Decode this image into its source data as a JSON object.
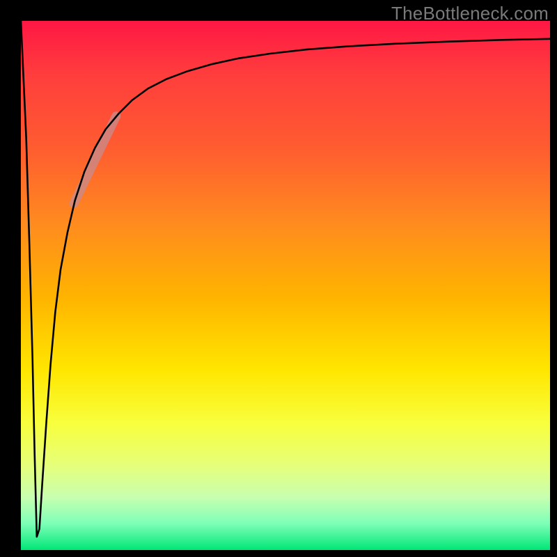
{
  "watermark": "TheBottleneck.com",
  "chart_data": {
    "type": "line",
    "title": "",
    "xlabel": "",
    "ylabel": "",
    "xlim": [
      0,
      100
    ],
    "ylim": [
      0,
      100
    ],
    "legend": false,
    "x": [
      0.0,
      1.0,
      1.6,
      2.2,
      2.6,
      3.0,
      3.5,
      4.0,
      4.8,
      5.6,
      6.5,
      7.5,
      8.8,
      10.2,
      12.0,
      14.0,
      16.0,
      18.5,
      21.0,
      24.0,
      27.5,
      31.5,
      36.0,
      41.0,
      47.0,
      54.0,
      62.0,
      71.0,
      81.0,
      91.0,
      100.0
    ],
    "values": [
      100.0,
      78.0,
      58.0,
      36.0,
      18.0,
      2.5,
      4.0,
      12.0,
      24.0,
      35.0,
      45.0,
      53.0,
      60.0,
      66.0,
      71.5,
      76.0,
      79.5,
      82.5,
      85.0,
      87.2,
      89.0,
      90.5,
      91.8,
      92.9,
      93.8,
      94.6,
      95.2,
      95.7,
      96.1,
      96.4,
      96.6
    ],
    "thick_band": {
      "x": [
        10.0,
        18.0
      ],
      "y": [
        65.5,
        82.0
      ]
    }
  }
}
